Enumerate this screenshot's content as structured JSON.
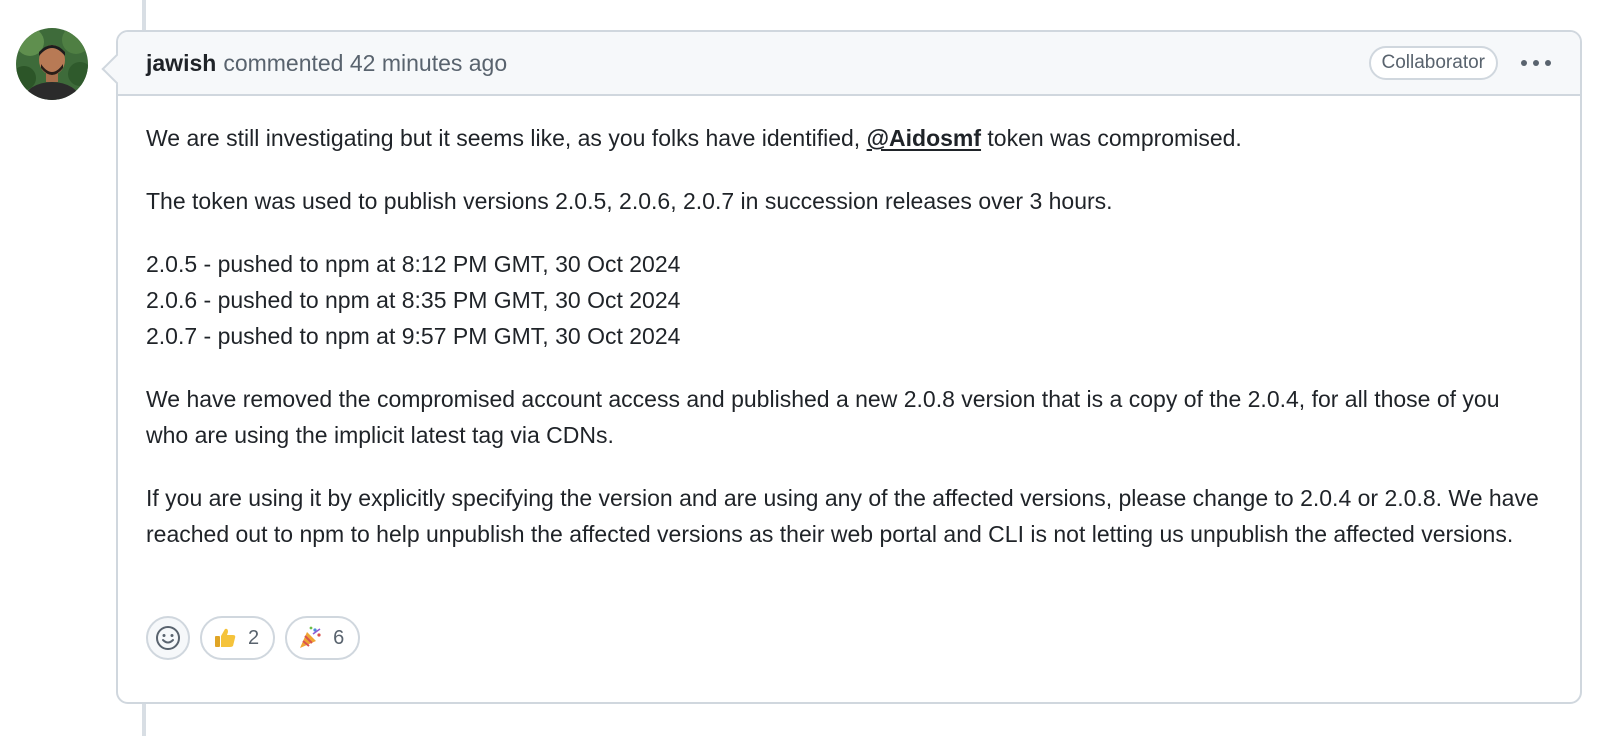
{
  "comment": {
    "author": "jawish",
    "action_text": "commented 42 minutes ago",
    "badge": "Collaborator",
    "more_icon": "kebab-horizontal-icon",
    "paragraph1_before": "We are still investigating but it seems like, as you folks have identified, ",
    "mention": "@Aidosmf",
    "paragraph1_after": " token was compromised.",
    "paragraph2": "The token was used to publish versions 2.0.5, 2.0.6, 2.0.7 in succession releases over 3 hours.",
    "release_lines": [
      "2.0.5 - pushed to npm at 8:12 PM GMT, 30 Oct 2024",
      "2.0.6 - pushed to npm at 8:35 PM GMT, 30 Oct 2024",
      "2.0.7 - pushed to npm at 9:57 PM GMT, 30 Oct 2024"
    ],
    "paragraph4": "We have removed the compromised account access and published a new 2.0.8 version that is a copy of the 2.0.4, for all those of you who are using the implicit latest tag via CDNs.",
    "paragraph5": "If you are using it by explicitly specifying the version and are using any of the affected versions, please change to 2.0.4 or 2.0.8. We have reached out to npm to help unpublish the affected versions as their web portal and CLI is not letting us unpublish the affected versions."
  },
  "reactions": {
    "add_icon": "smiley-icon",
    "items": [
      {
        "icon": "thumbs-up-icon",
        "count": "2"
      },
      {
        "icon": "party-popper-icon",
        "count": "6"
      }
    ]
  },
  "colors": {
    "border": "#d0d7de",
    "header_bg": "#f6f8fa",
    "text": "#1f2328",
    "muted": "#59636e"
  }
}
